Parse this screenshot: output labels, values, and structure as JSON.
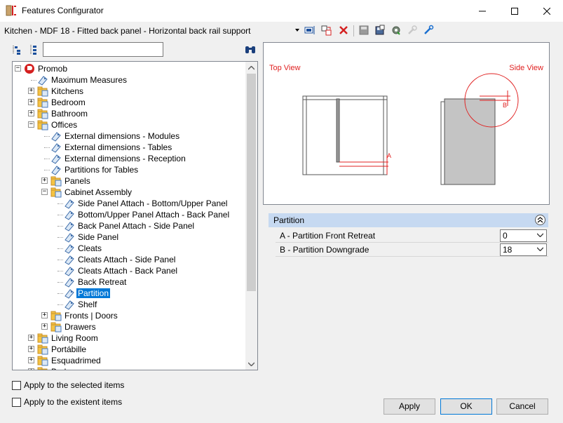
{
  "window": {
    "title": "Features Configurator"
  },
  "toolbar": {
    "selection": "Kitchen - MDF 18 - Fitted back panel - Horizontal back rail support"
  },
  "tree": {
    "search_value": "",
    "items": [
      {
        "label": "Promob",
        "level": 0,
        "expander": "minus",
        "icon": "promob-logo-icon"
      },
      {
        "label": "Maximum Measures",
        "level": 1,
        "expander": "none",
        "icon": "tag-icon"
      },
      {
        "label": "Kitchens",
        "level": 1,
        "expander": "plus",
        "icon": "folder-icon"
      },
      {
        "label": "Bedroom",
        "level": 1,
        "expander": "plus",
        "icon": "folder-icon"
      },
      {
        "label": "Bathroom",
        "level": 1,
        "expander": "plus",
        "icon": "folder-icon"
      },
      {
        "label": "Offices",
        "level": 1,
        "expander": "minus",
        "icon": "folder-open-icon"
      },
      {
        "label": "External dimensions - Modules",
        "level": 2,
        "expander": "none",
        "icon": "tag-icon"
      },
      {
        "label": "External dimensions - Tables",
        "level": 2,
        "expander": "none",
        "icon": "tag-icon"
      },
      {
        "label": "External dimensions - Reception",
        "level": 2,
        "expander": "none",
        "icon": "tag-icon"
      },
      {
        "label": "Partitions for Tables",
        "level": 2,
        "expander": "none",
        "icon": "tag-icon"
      },
      {
        "label": "Panels",
        "level": 2,
        "expander": "plus",
        "icon": "folder-icon"
      },
      {
        "label": "Cabinet Assembly",
        "level": 2,
        "expander": "minus",
        "icon": "folder-open-icon"
      },
      {
        "label": "Side Panel Attach - Bottom/Upper Panel",
        "level": 3,
        "expander": "none",
        "icon": "tag-icon"
      },
      {
        "label": " Bottom/Upper Panel Attach - Back Panel",
        "level": 3,
        "expander": "none",
        "icon": "tag-icon"
      },
      {
        "label": "Back Panel Attach - Side Panel",
        "level": 3,
        "expander": "none",
        "icon": "tag-icon"
      },
      {
        "label": "Side Panel",
        "level": 3,
        "expander": "none",
        "icon": "tag-icon"
      },
      {
        "label": "Cleats",
        "level": 3,
        "expander": "none",
        "icon": "tag-icon"
      },
      {
        "label": "Cleats Attach - Side Panel",
        "level": 3,
        "expander": "none",
        "icon": "tag-icon"
      },
      {
        "label": "Cleats Attach - Back Panel",
        "level": 3,
        "expander": "none",
        "icon": "tag-icon"
      },
      {
        "label": "Back Retreat",
        "level": 3,
        "expander": "none",
        "icon": "tag-icon"
      },
      {
        "label": "Partition",
        "level": 3,
        "expander": "none",
        "icon": "tag-icon",
        "selected": true
      },
      {
        "label": "Shelf",
        "level": 3,
        "expander": "none",
        "icon": "tag-icon"
      },
      {
        "label": "Fronts | Doors",
        "level": 2,
        "expander": "plus",
        "icon": "folder-icon"
      },
      {
        "label": "Drawers",
        "level": 2,
        "expander": "plus",
        "icon": "folder-icon"
      },
      {
        "label": "Living Room",
        "level": 1,
        "expander": "plus",
        "icon": "folder-icon"
      },
      {
        "label": "Portábille",
        "level": 1,
        "expander": "plus",
        "icon": "folder-icon"
      },
      {
        "label": "Esquadrimed",
        "level": 1,
        "expander": "plus",
        "icon": "folder-icon"
      },
      {
        "label": "Bed",
        "level": 1,
        "expander": "plus",
        "icon": "folder-icon"
      }
    ]
  },
  "checkboxes": {
    "apply_selected": "Apply to the selected items",
    "apply_existent": "Apply to the existent items"
  },
  "preview": {
    "top_view": "Top View",
    "side_view": "Side View",
    "marker_a": "A",
    "marker_b": "B"
  },
  "properties": {
    "category": "Partition",
    "rows": [
      {
        "label": "A - Partition Front Retreat",
        "value": "0"
      },
      {
        "label": "B - Partition Downgrade",
        "value": "18"
      }
    ]
  },
  "buttons": {
    "apply": "Apply",
    "ok": "OK",
    "cancel": "Cancel"
  },
  "colors": {
    "selection": "#0078d7",
    "annotation": "#e02020",
    "header": "#c6d9f1"
  }
}
